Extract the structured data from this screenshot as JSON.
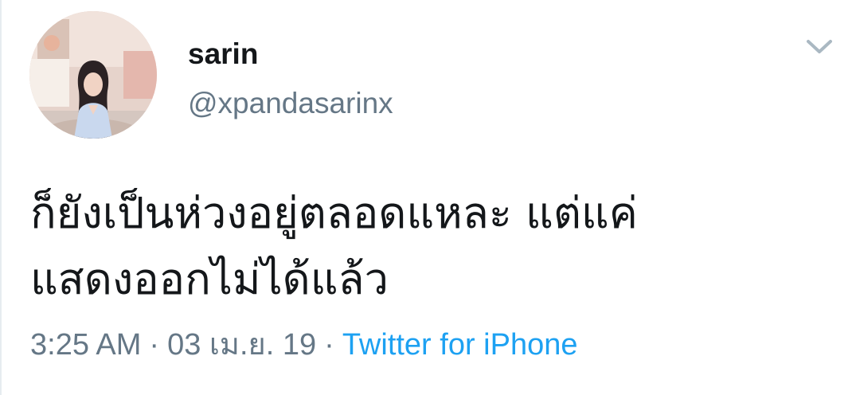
{
  "user": {
    "display_name": "sarin",
    "handle": "@xpandasarinx"
  },
  "icons": {
    "more": "chevron-down-icon",
    "avatar": "profile-photo"
  },
  "tweet": {
    "text_line_1": "ก็ยังเป็นห่วงอยู่ตลอดแหละ แต่แค่",
    "text_line_2": "แสดงออกไม่ได้แล้ว",
    "time": "3:25 AM",
    "separator": "·",
    "date": "03 เม.ย. 19",
    "source": "Twitter for iPhone"
  },
  "colors": {
    "text": "#14171a",
    "secondary": "#657786",
    "link": "#1da1f2",
    "chevron": "#aab8c2"
  }
}
